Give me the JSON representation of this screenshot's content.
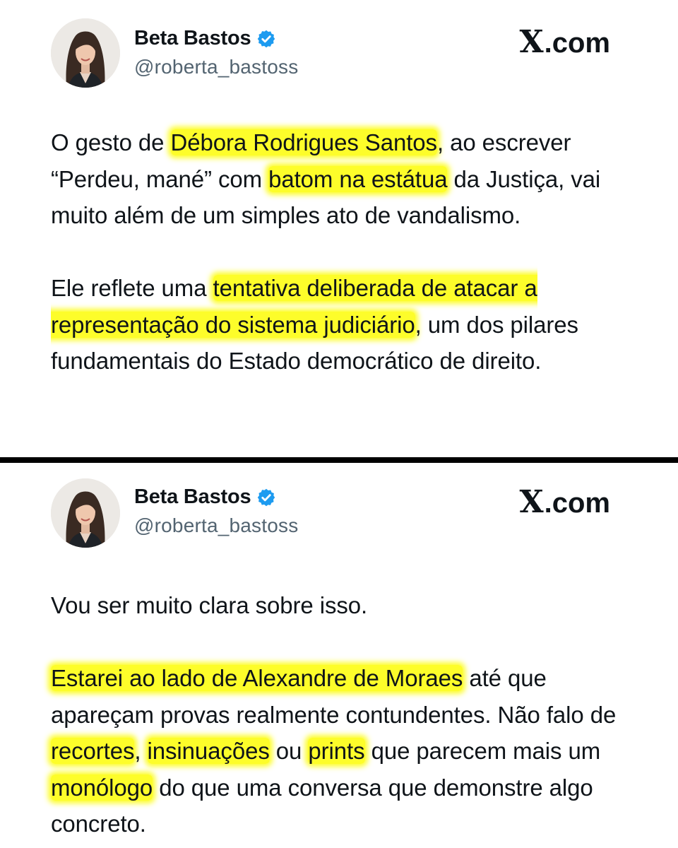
{
  "tweets": [
    {
      "author": {
        "name": "Beta Bastos",
        "handle": "@roberta_bastoss"
      },
      "brand": {
        "x": "X",
        "rest": ".com"
      },
      "paragraphs": [
        [
          {
            "text": "O gesto de ",
            "highlight": false
          },
          {
            "text": "Débora Rodrigues Santos",
            "highlight": true
          },
          {
            "text": ", ao escrever “Perdeu, mané” com ",
            "highlight": false
          },
          {
            "text": "batom na estátua",
            "highlight": true
          },
          {
            "text": " da Justiça, vai muito além de um simples ato de vandalismo.",
            "highlight": false
          }
        ],
        [
          {
            "text": "Ele reflete uma ",
            "highlight": false
          },
          {
            "text": "tentativa deliberada de atacar a representação do sistema judiciário",
            "highlight": true
          },
          {
            "text": ", um dos pilares fundamentais do Estado democrático de direito.",
            "highlight": false
          }
        ]
      ]
    },
    {
      "author": {
        "name": "Beta Bastos",
        "handle": "@roberta_bastoss"
      },
      "brand": {
        "x": "X",
        "rest": ".com"
      },
      "paragraphs": [
        [
          {
            "text": "Vou ser muito clara sobre isso.",
            "highlight": false
          }
        ],
        [
          {
            "text": "Estarei ao lado de Alexandre de Moraes",
            "highlight": true
          },
          {
            "text": " até que apareçam provas realmente contundentes. Não falo de ",
            "highlight": false
          },
          {
            "text": "recortes",
            "highlight": true
          },
          {
            "text": ", ",
            "highlight": false
          },
          {
            "text": "insinuações",
            "highlight": true
          },
          {
            "text": " ou ",
            "highlight": false
          },
          {
            "text": "prints",
            "highlight": true
          },
          {
            "text": " que parecem mais um ",
            "highlight": false
          },
          {
            "text": "monólogo",
            "highlight": true
          },
          {
            "text": " do que uma conversa que demonstre algo concreto.",
            "highlight": false
          }
        ]
      ]
    }
  ],
  "colors": {
    "highlight": "#fdfd2a",
    "verified": "#1d9bf0",
    "handle": "#536471",
    "text": "#0f1419",
    "divider": "#000000"
  },
  "icons": {
    "verified": "verified-badge-icon",
    "avatar": "profile-photo"
  }
}
